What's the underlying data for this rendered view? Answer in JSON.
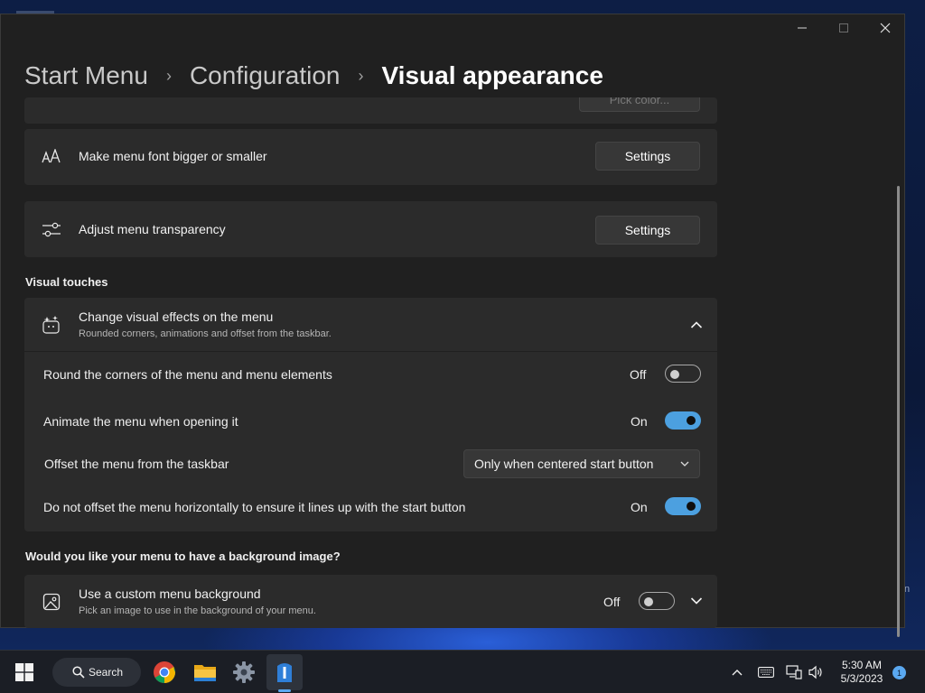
{
  "window": {
    "caption": {
      "minimize_glyph": "—",
      "maximize_glyph": "☐",
      "close_glyph": "✕"
    }
  },
  "breadcrumb": {
    "items": [
      "Start Menu",
      "Configuration",
      "Visual appearance"
    ],
    "separator": "›"
  },
  "partial_card": {
    "button_label": "Pick color..."
  },
  "font_setting": {
    "title": "Make menu font bigger or smaller",
    "button_label": "Settings",
    "icon": "font-size-icon"
  },
  "transparency_setting": {
    "title": "Adjust menu transparency",
    "button_label": "Settings",
    "icon": "sliders-icon"
  },
  "visual_touches": {
    "section_title": "Visual touches",
    "expander": {
      "title": "Change visual effects on the menu",
      "subtitle": "Rounded corners, animations and offset from the taskbar.",
      "icon": "visual-effects-icon",
      "expanded": true
    },
    "round_corners": {
      "label": "Round the corners of the menu and menu elements",
      "state": "Off",
      "on": false
    },
    "animate": {
      "label": "Animate the menu when opening it",
      "state": "On",
      "on": true
    },
    "offset": {
      "label": "Offset the menu from the taskbar",
      "selected": "Only when centered start button"
    },
    "no_horizontal_offset": {
      "label": "Do not offset the menu horizontally to ensure it lines up with the start button",
      "state": "On",
      "on": true
    }
  },
  "background_image": {
    "section_title": "Would you like your menu to have a background image?",
    "custom": {
      "title": "Use a custom menu background",
      "subtitle": "Pick an image to use in the background of your menu.",
      "state": "Off",
      "on": false,
      "icon": "image-icon"
    }
  },
  "taskbar": {
    "search_label": "Search",
    "apps": [
      "windows-start-icon",
      "chrome-icon",
      "file-explorer-icon",
      "settings-gear-icon",
      "start-menu-app-icon"
    ],
    "time": "5:30 AM",
    "date": "5/3/2023",
    "notification_count": "1"
  },
  "colors": {
    "accent": "#4ca0e0",
    "window_bg": "#202020",
    "card_bg": "#2b2b2b"
  }
}
